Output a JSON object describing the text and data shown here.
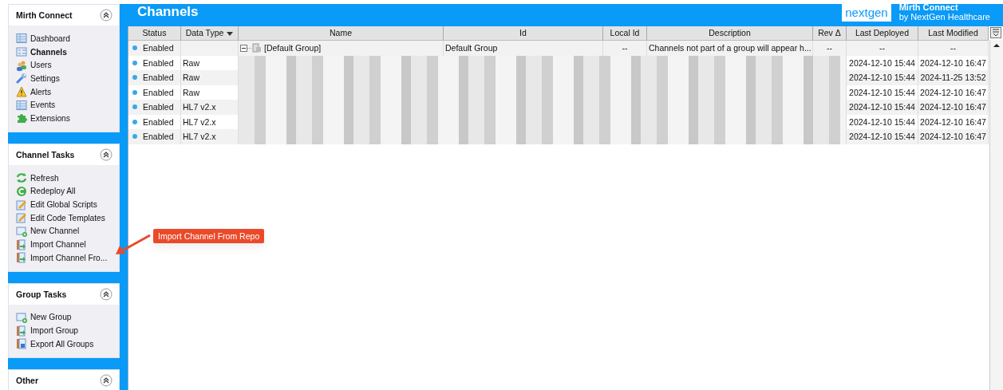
{
  "sidebar": {
    "panels": [
      {
        "title": "Mirth Connect",
        "items": [
          {
            "label": "Dashboard",
            "kind": "table",
            "selected": false
          },
          {
            "label": "Channels",
            "kind": "list",
            "selected": true
          },
          {
            "label": "Users",
            "kind": "users",
            "selected": false
          },
          {
            "label": "Settings",
            "kind": "wrench",
            "selected": false
          },
          {
            "label": "Alerts",
            "kind": "warning",
            "selected": false
          },
          {
            "label": "Events",
            "kind": "table",
            "selected": false
          },
          {
            "label": "Extensions",
            "kind": "puzzle",
            "selected": false
          }
        ]
      },
      {
        "title": "Channel Tasks",
        "items": [
          {
            "label": "Refresh",
            "kind": "refresh",
            "selected": false
          },
          {
            "label": "Redeploy All",
            "kind": "redeploy",
            "selected": false
          },
          {
            "label": "Edit Global Scripts",
            "kind": "edit",
            "selected": false
          },
          {
            "label": "Edit Code Templates",
            "kind": "edit",
            "selected": false
          },
          {
            "label": "New Channel",
            "kind": "new",
            "selected": false
          },
          {
            "label": "Import Channel",
            "kind": "import",
            "selected": false
          },
          {
            "label": "Import Channel Fro...",
            "kind": "import",
            "selected": false
          }
        ]
      },
      {
        "title": "Group Tasks",
        "items": [
          {
            "label": "New Group",
            "kind": "new",
            "selected": false
          },
          {
            "label": "Import Group",
            "kind": "import",
            "selected": false
          },
          {
            "label": "Export All Groups",
            "kind": "export",
            "selected": false
          }
        ]
      },
      {
        "title": "Other"
      }
    ]
  },
  "header": {
    "title": "Channels",
    "logo": {
      "word_a": "next",
      "word_b": "gen",
      "product": "Mirth Connect",
      "byline": "by NextGen Healthcare"
    }
  },
  "table": {
    "columns": [
      "Status",
      "Data Type",
      "Name",
      "Id",
      "Local Id",
      "Description",
      "Rev Δ",
      "Last Deployed",
      "Last Modified"
    ],
    "rows": [
      {
        "kind": "group",
        "status": "Enabled",
        "data_type": "",
        "name": "[Default Group]",
        "id": "Default Group",
        "local_id": "--",
        "description": "Channels not part of a group will appear h...",
        "rev": "--",
        "last_deployed": "--",
        "last_modified": "--"
      },
      {
        "kind": "channel",
        "status": "Enabled",
        "data_type": "Raw",
        "last_deployed": "2024-12-10 15:44",
        "last_modified": "2024-12-10 16:47"
      },
      {
        "kind": "channel",
        "status": "Enabled",
        "data_type": "Raw",
        "last_deployed": "2024-12-10 15:44",
        "last_modified": "2024-11-25 13:52"
      },
      {
        "kind": "channel",
        "status": "Enabled",
        "data_type": "Raw",
        "last_deployed": "2024-12-10 15:44",
        "last_modified": "2024-12-10 16:47"
      },
      {
        "kind": "channel",
        "status": "Enabled",
        "data_type": "HL7 v2.x",
        "last_deployed": "2024-12-10 15:44",
        "last_modified": "2024-12-10 16:47"
      },
      {
        "kind": "channel",
        "status": "Enabled",
        "data_type": "HL7 v2.x",
        "last_deployed": "2024-12-10 15:44",
        "last_modified": "2024-12-10 16:47"
      },
      {
        "kind": "channel",
        "status": "Enabled",
        "data_type": "HL7 v2.x",
        "last_deployed": "2024-12-10 15:44",
        "last_modified": "2024-12-10 16:47"
      }
    ]
  },
  "annotation": {
    "label": "Import Channel From Repo"
  }
}
